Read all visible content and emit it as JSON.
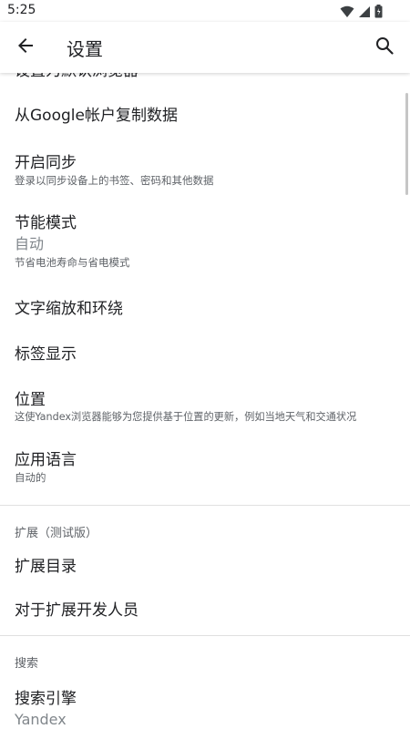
{
  "status_bar": {
    "time": "5:25",
    "icons": [
      "wifi-icon",
      "signal-icon",
      "battery-icon"
    ]
  },
  "app_bar": {
    "back_icon": "arrow-back-icon",
    "title": "设置",
    "search_icon": "search-icon"
  },
  "items": [
    {
      "title": "设置为默认浏览器"
    },
    {
      "title": "从Google帐户复制数据"
    },
    {
      "title": "开启同步",
      "summary": "登录以同步设备上的书签、密码和其他数据"
    },
    {
      "title": "节能模式",
      "value": "自动",
      "summary": "节省电池寿命与省电模式"
    },
    {
      "title": "文字缩放和环绕"
    },
    {
      "title": "标签显示"
    },
    {
      "title": "位置",
      "summary": "这使Yandex浏览器能够为您提供基于位置的更新，例如当地天气和交通状况"
    },
    {
      "title": "应用语言",
      "summary": "自动的"
    }
  ],
  "sections": [
    {
      "header": "扩展（测试版）",
      "items": [
        {
          "title": "扩展目录"
        },
        {
          "title": "对于扩展开发人员"
        }
      ]
    },
    {
      "header": "搜索",
      "items": [
        {
          "title": "搜索引擎",
          "value": "Yandex"
        }
      ]
    }
  ],
  "colors": {
    "primary_text": "#202124",
    "secondary_text": "#5f6368",
    "value_text": "#80868b",
    "divider": "#e0e0e0"
  }
}
